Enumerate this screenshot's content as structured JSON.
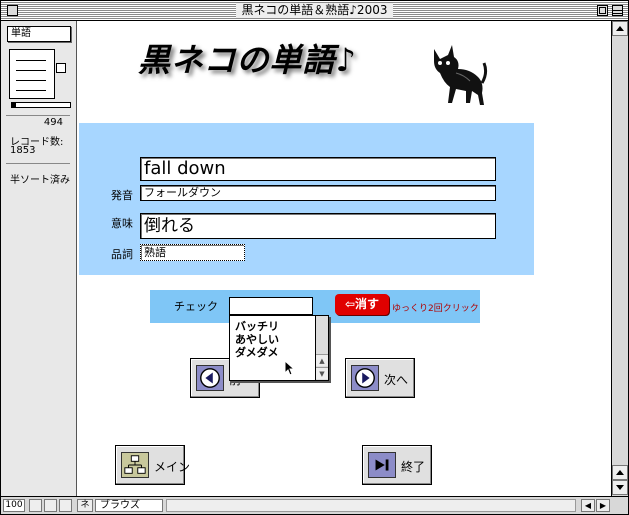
{
  "window": {
    "title": "黒ネコの単語＆熟語♪2003"
  },
  "status_area": {
    "layout_name": "単語",
    "total_records": "494",
    "record_count_label": "レコード数:",
    "record_count": "1853",
    "sort_status": "半ソート済み"
  },
  "header": {
    "app_title": "黒ネコの単語♪"
  },
  "record": {
    "word": "fall down",
    "reading_label": "発音",
    "reading": "フォールダウン",
    "meaning_label": "意味",
    "meaning": "倒れる",
    "pos_label": "品詞",
    "pos": "熟語"
  },
  "check": {
    "label": "チェック",
    "value": "",
    "erase_button": "⇦消す",
    "hint": "ゆっくり2回クリック",
    "options": [
      "バッチリ",
      "あやしい",
      "ダメダメ"
    ]
  },
  "buttons": {
    "prev_label": "前",
    "next_label": "次へ",
    "main_label": "メイン",
    "quit_label": "終了"
  },
  "bottom_bar": {
    "zoom": "100",
    "mode_icon": "ネ",
    "mode": "ブラウズ"
  },
  "colors": {
    "panel_blue": "#a7d6ff",
    "check_bar_blue": "#7fc6f6",
    "erase_red": "#e00000",
    "button_icon_purple": "#8c8cc8"
  },
  "icons": [
    "close-box-icon",
    "zoom-box-icon",
    "collapse-box-icon",
    "book-icon",
    "cat-image",
    "prev-arrow-icon",
    "next-arrow-icon",
    "org-chart-icon",
    "skip-end-icon",
    "mouse-cursor-icon"
  ]
}
